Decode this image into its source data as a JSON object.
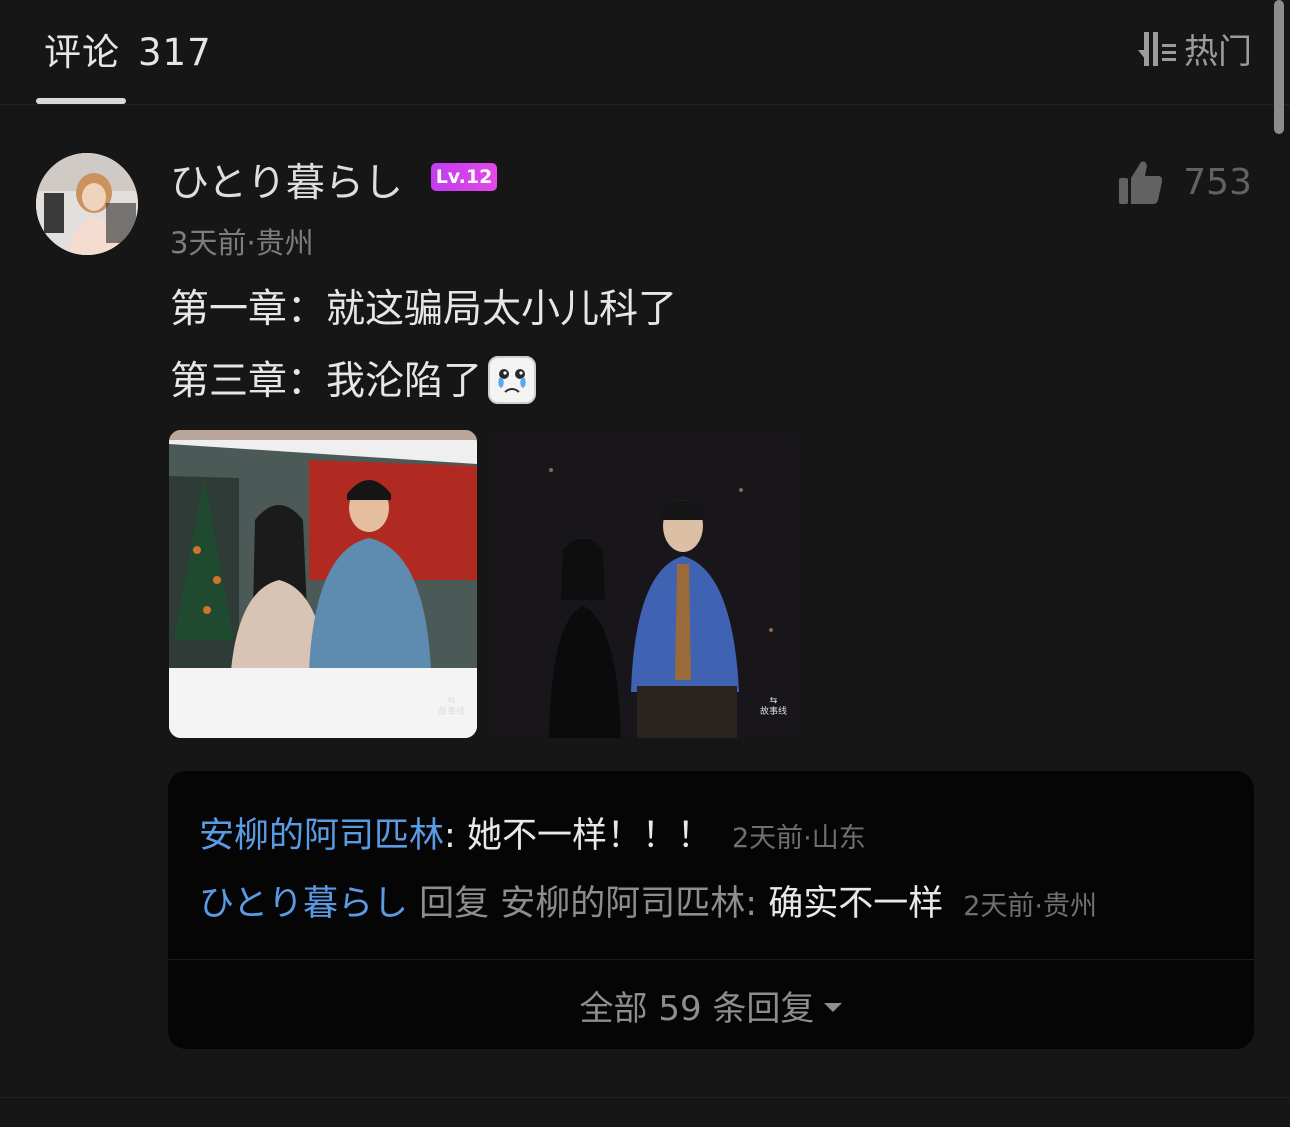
{
  "header": {
    "tab_label": "评论",
    "comment_count": "317",
    "sort_label": "热门"
  },
  "comment": {
    "username": "ひとり暮らし",
    "level": "Lv.12",
    "time_location": "3天前·贵州",
    "likes": "753",
    "lines": [
      "第一章：就这骗局太小儿科了",
      "第三章：我沦陷了"
    ],
    "images": [
      {
        "alt": "Couple in front of Christmas tree",
        "watermark": "故事线"
      },
      {
        "alt": "Couple portrait in dark setting",
        "watermark": "故事线"
      }
    ],
    "icons": {
      "like": "thumbs-up-icon",
      "sort": "sort-icon",
      "emoji": "crying-emoji-icon"
    }
  },
  "replies": [
    {
      "name": "安柳的阿司匹林",
      "colon": ":",
      "text": "她不一样！！！",
      "time_location": "2天前·山东"
    },
    {
      "name": "ひとり暮らし",
      "reply_word": "回复",
      "target": "安柳的阿司匹林",
      "colon": ":",
      "text": "确实不一样",
      "time_location": "2天前·贵州"
    }
  ],
  "all_replies_label": "全部 59 条回复",
  "colors": {
    "name_link": "#5b9be6",
    "level_badge": "#c23cf0",
    "background": "#161616"
  }
}
